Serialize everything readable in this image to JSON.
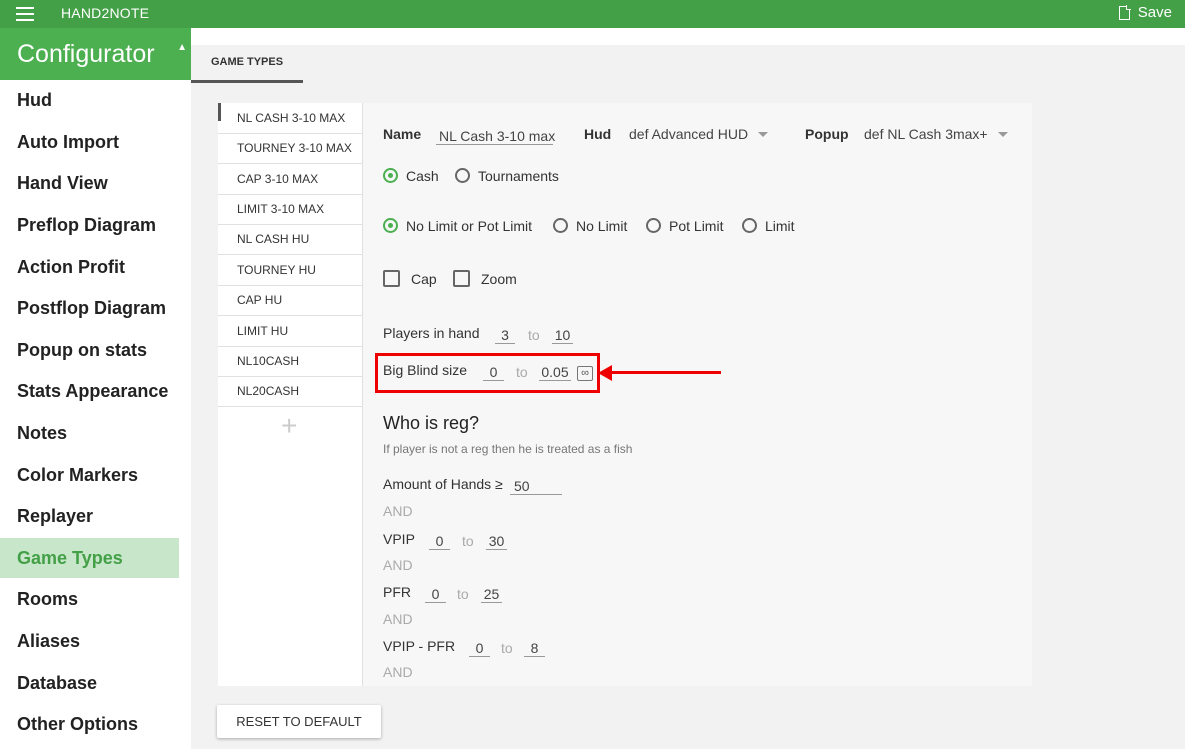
{
  "topbar": {
    "app_title": "HAND2NOTE",
    "save_label": "Save"
  },
  "sidebar": {
    "title": "Configurator",
    "items": [
      {
        "label": "Hud"
      },
      {
        "label": "Auto Import"
      },
      {
        "label": "Hand View"
      },
      {
        "label": "Preflop Diagram"
      },
      {
        "label": "Action Profit"
      },
      {
        "label": "Postflop Diagram"
      },
      {
        "label": "Popup on stats"
      },
      {
        "label": "Stats Appearance"
      },
      {
        "label": "Notes"
      },
      {
        "label": "Color Markers"
      },
      {
        "label": "Replayer"
      },
      {
        "label": "Game Types",
        "active": true
      },
      {
        "label": "Rooms"
      },
      {
        "label": "Aliases"
      },
      {
        "label": "Database"
      },
      {
        "label": "Other Options"
      }
    ]
  },
  "tab": {
    "label": "GAME TYPES"
  },
  "game_types": [
    "NL CASH 3-10 MAX",
    "TOURNEY 3-10 MAX",
    "CAP 3-10 MAX",
    "LIMIT 3-10 MAX",
    "NL CASH HU",
    "TOURNEY HU",
    "CAP HU",
    "LIMIT HU",
    "NL10CASH",
    "NL20CASH"
  ],
  "add_label": "+",
  "form": {
    "name_label": "Name",
    "name_value": "NL Cash 3-10 max",
    "hud_label": "Hud",
    "hud_value": "def Advanced HUD",
    "popup_label": "Popup",
    "popup_value": "def NL Cash 3max+",
    "game_kind": {
      "cash": "Cash",
      "tournaments": "Tournaments",
      "selected": "Cash"
    },
    "limit_type": {
      "nl_or_pl": "No Limit or Pot Limit",
      "nl": "No Limit",
      "pl": "Pot Limit",
      "limit": "Limit",
      "selected": "No Limit or Pot Limit"
    },
    "flags": {
      "cap": "Cap",
      "zoom": "Zoom"
    },
    "players": {
      "label": "Players in hand",
      "from": "3",
      "to_label": "to",
      "to": "10"
    },
    "big_blind": {
      "label": "Big Blind size",
      "from": "0",
      "to_label": "to",
      "to": "0.05",
      "inf_label": "∞"
    },
    "reg": {
      "heading": "Who is reg?",
      "subtitle": "If player is not a reg then he is treated as a fish",
      "hands_label": "Amount of Hands ≥",
      "hands_value": "50",
      "and": "AND",
      "vpip": {
        "label": "VPIP",
        "from": "0",
        "to_label": "to",
        "to": "30"
      },
      "pfr": {
        "label": "PFR",
        "from": "0",
        "to_label": "to",
        "to": "25"
      },
      "vpip_pfr": {
        "label": "VPIP - PFR",
        "from": "0",
        "to_label": "to",
        "to": "8"
      }
    }
  },
  "reset_label": "RESET TO DEFAULT",
  "colors": {
    "topbar": "#43a047",
    "header": "#4caf50",
    "active_bg": "#c8e6c9",
    "highlight": "#ee0000"
  }
}
